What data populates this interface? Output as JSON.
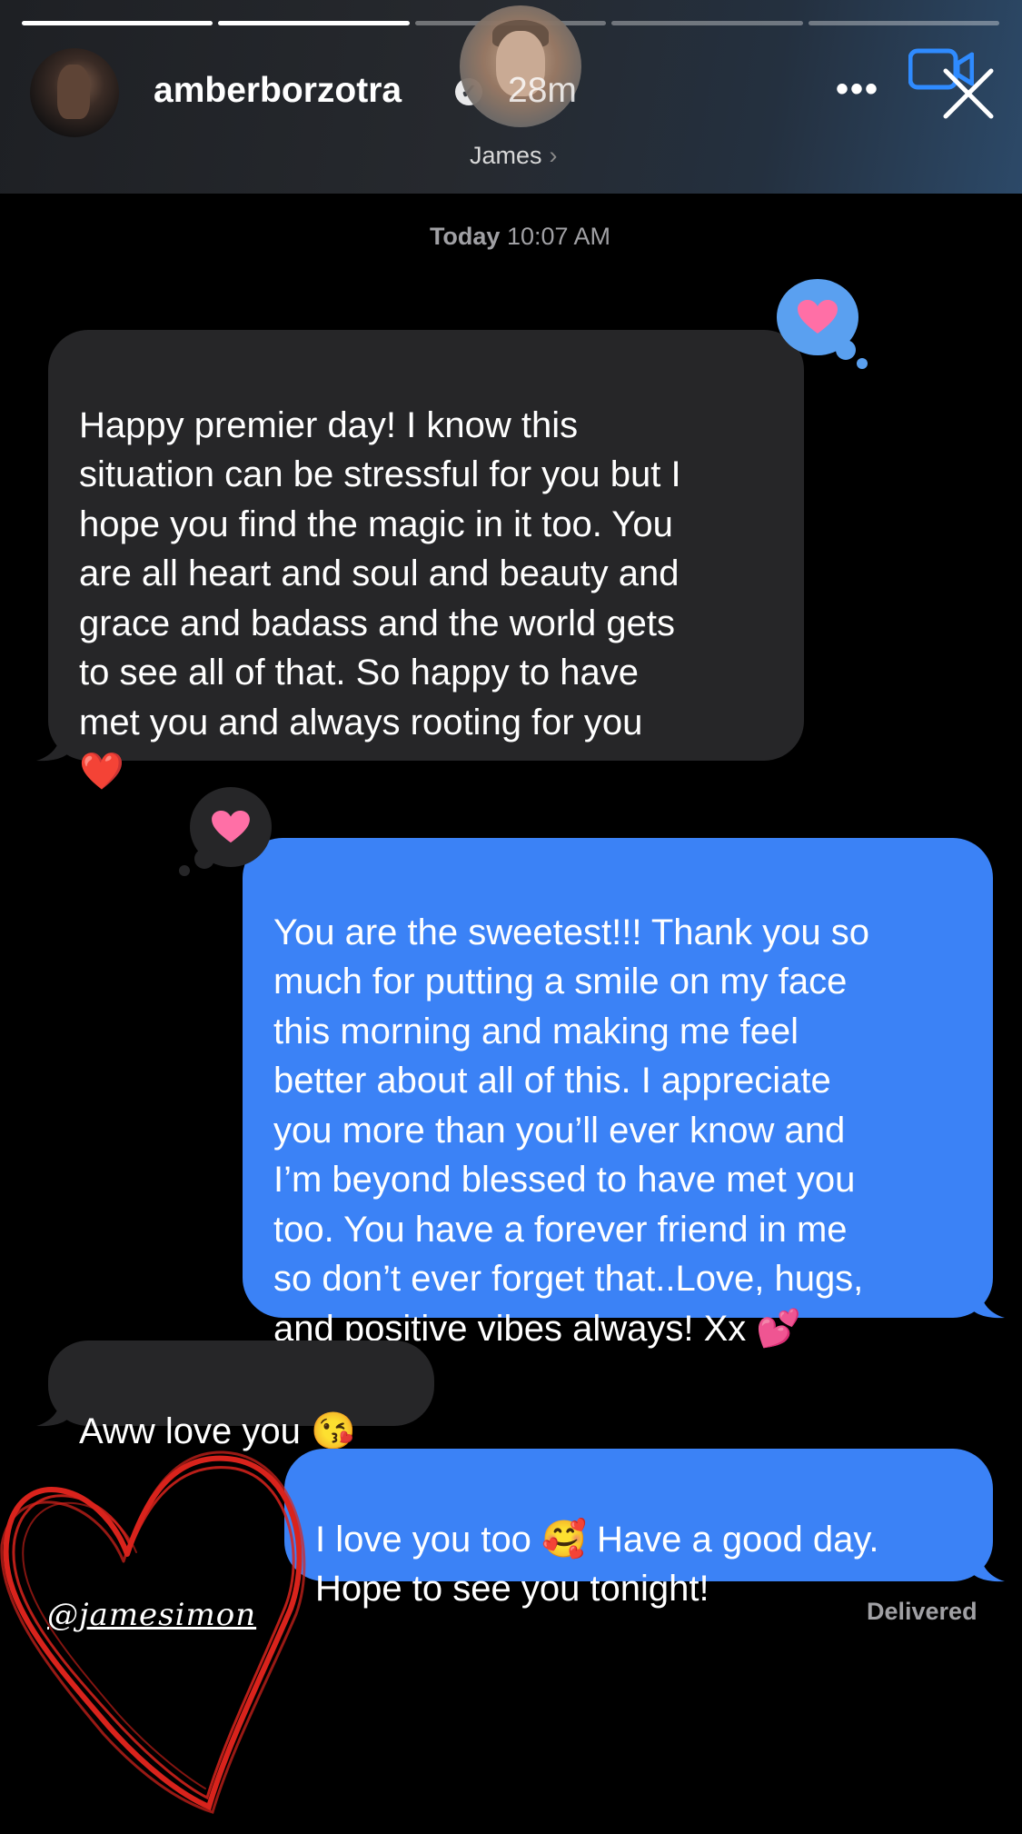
{
  "story": {
    "username": "amberborzotra",
    "time_ago": "28m",
    "progress": {
      "segments": 5,
      "completed": 2
    }
  },
  "conversation": {
    "contact_name": "James",
    "timestamp_day": "Today",
    "timestamp_time": "10:07 AM",
    "messages": [
      {
        "direction": "incoming",
        "text": "Happy premier day! I know this\nsituation can be stressful for you but I\nhope you find the magic in it too. You\nare all heart and soul and beauty and\ngrace and badass and the world gets\nto see all of that. So happy to have\nmet you and always rooting for you\n❤️",
        "tapback": "heart"
      },
      {
        "direction": "outgoing",
        "text": "You are the sweetest!!! Thank you so\nmuch for putting a smile on my face\nthis morning and making me feel\nbetter about all of this. I appreciate\nyou more than you’ll ever know and\nI’m beyond blessed to have met you\ntoo. You have a forever friend in me\nso don’t ever forget that..Love, hugs,\nand positive vibes always! Xx 💕",
        "tapback": "heart"
      },
      {
        "direction": "incoming",
        "text": "Aww love you 😘"
      },
      {
        "direction": "outgoing",
        "text": "I love you too 🥰 Have a good day.\nHope to see you tonight!"
      }
    ],
    "status": "Delivered"
  },
  "sticker": {
    "mention": "@jamesimon"
  },
  "colors": {
    "incoming_bubble": "#262628",
    "outgoing_bubble": "#3b82f6",
    "tapback_pink": "#ff6fa6",
    "sticker_red": "#d9231c"
  }
}
